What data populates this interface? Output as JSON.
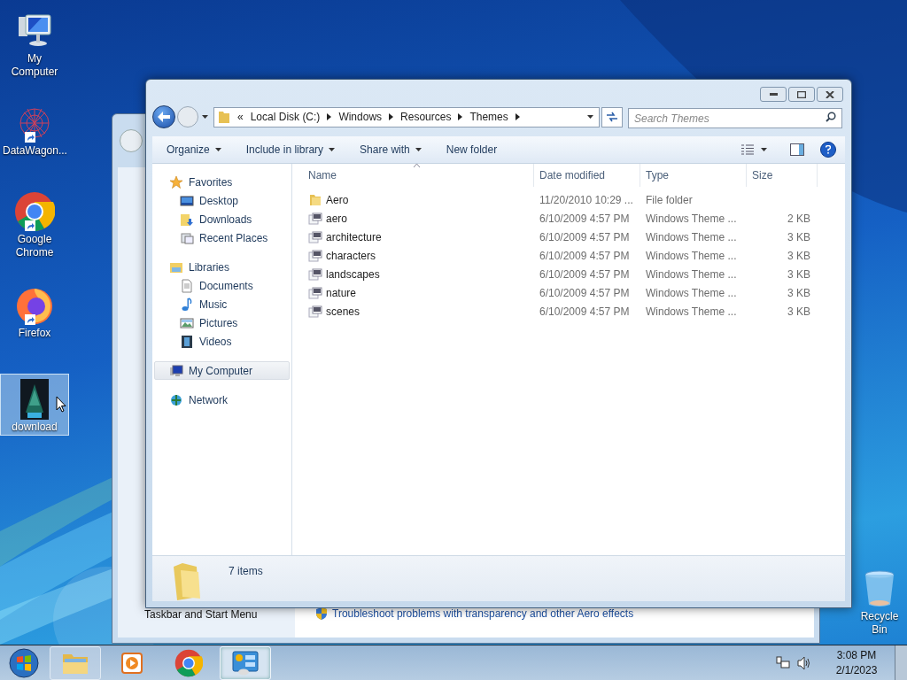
{
  "desktop_icons": [
    {
      "label": "My Computer",
      "kind": "computer",
      "shortcut": false,
      "selected": false
    },
    {
      "label": "DataWagon...",
      "kind": "network-art",
      "shortcut": true,
      "selected": false
    },
    {
      "label": "Google Chrome",
      "kind": "chrome",
      "shortcut": true,
      "selected": false
    },
    {
      "label": "Firefox",
      "kind": "firefox",
      "shortcut": true,
      "selected": false
    },
    {
      "label": "download",
      "shortcut": false,
      "selected": true
    },
    {
      "label": "Recycle Bin",
      "kind": "bin",
      "shortcut": false,
      "selected": false
    }
  ],
  "background_window": {
    "left_item": "Taskbar and Start Menu",
    "link": "Troubleshoot problems with transparency and other Aero effects"
  },
  "explorer": {
    "overflow": "«",
    "breadcrumb": [
      "Local Disk (C:)",
      "Windows",
      "Resources",
      "Themes"
    ],
    "search": {
      "placeholder": "Search Themes"
    },
    "toolbar": [
      {
        "label": "Organize",
        "dropdown": true
      },
      {
        "label": "Include in library",
        "dropdown": true
      },
      {
        "label": "Share with",
        "dropdown": true
      },
      {
        "label": "New folder",
        "dropdown": false
      }
    ],
    "nav": [
      {
        "label": "Favorites",
        "kind": "star",
        "selected": false,
        "children": [
          {
            "label": "Desktop",
            "kind": "desktop",
            "selected": false
          },
          {
            "label": "Downloads",
            "kind": "downloads",
            "selected": false
          },
          {
            "label": "Recent Places",
            "kind": "recent",
            "selected": false
          }
        ]
      },
      {
        "label": "Libraries",
        "kind": "library",
        "selected": false,
        "children": [
          {
            "label": "Documents",
            "kind": "document",
            "selected": false
          },
          {
            "label": "Music",
            "kind": "music",
            "selected": false
          },
          {
            "label": "Pictures",
            "kind": "pictures",
            "selected": false
          },
          {
            "label": "Videos",
            "kind": "video",
            "selected": false
          }
        ]
      },
      {
        "label": "My Computer",
        "kind": "computer",
        "selected": true
      },
      {
        "label": "Network",
        "kind": "network",
        "selected": false
      }
    ],
    "columns": [
      "Name",
      "Date modified",
      "Type",
      "Size"
    ],
    "files": [
      {
        "name": "Aero",
        "date": "11/20/2010 10:29 ...",
        "type": "File folder",
        "kind": "folder"
      },
      {
        "name": "aero",
        "date": "6/10/2009 4:57 PM",
        "type": "Windows Theme ...",
        "size": "2 KB",
        "kind": "theme"
      },
      {
        "name": "architecture",
        "date": "6/10/2009 4:57 PM",
        "type": "Windows Theme ...",
        "size": "3 KB",
        "kind": "theme"
      },
      {
        "name": "characters",
        "date": "6/10/2009 4:57 PM",
        "type": "Windows Theme ...",
        "size": "3 KB",
        "kind": "theme"
      },
      {
        "name": "landscapes",
        "date": "6/10/2009 4:57 PM",
        "type": "Windows Theme ...",
        "size": "3 KB",
        "kind": "theme"
      },
      {
        "name": "nature",
        "date": "6/10/2009 4:57 PM",
        "type": "Windows Theme ...",
        "size": "3 KB",
        "kind": "theme"
      },
      {
        "name": "scenes",
        "date": "6/10/2009 4:57 PM",
        "type": "Windows Theme ...",
        "size": "3 KB",
        "kind": "theme"
      }
    ],
    "status": "7 items"
  },
  "taskbar": {
    "apps": [
      {
        "kind": "explorer",
        "selected": false
      },
      {
        "kind": "media",
        "selected": false
      },
      {
        "kind": "chrome",
        "selected": false
      },
      {
        "kind": "control-panel",
        "selected": true
      }
    ],
    "time": "3:08 PM",
    "date": "2/1/2023"
  }
}
